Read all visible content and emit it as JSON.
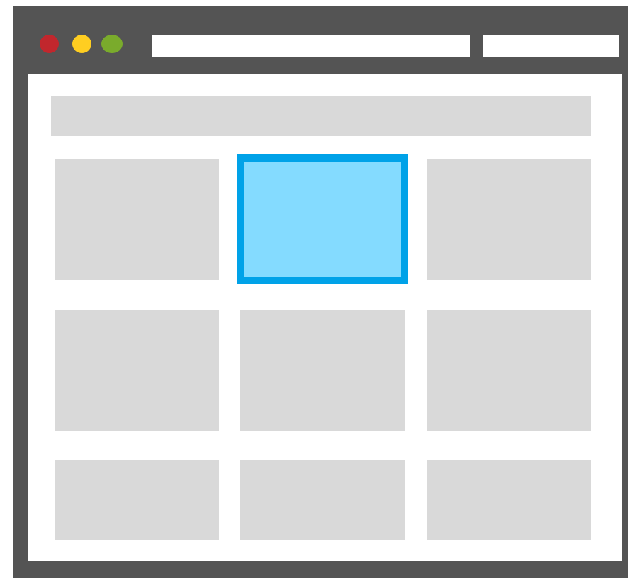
{
  "colors": {
    "window_frame": "#545454",
    "window_button_close": "#C1272D",
    "window_button_minimize": "#FFCE21",
    "window_button_maximize": "#7AAB2C",
    "placeholder_tile": "#D9D9D9",
    "selected_tile_fill": "#84DBFF",
    "selected_tile_border": "#00A2E8"
  },
  "address_bar": {
    "value": "",
    "placeholder": ""
  },
  "search_bar": {
    "value": "",
    "placeholder": ""
  },
  "grid": {
    "rows": 3,
    "columns": 3,
    "selected_tile": {
      "row": 1,
      "column": 2
    }
  }
}
